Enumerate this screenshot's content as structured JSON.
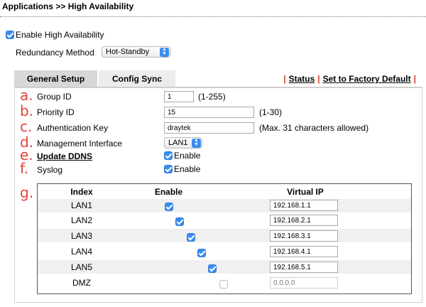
{
  "breadcrumb": "Applications >> High Availability",
  "enable_ha": {
    "label": "Enable High Availability",
    "checked": true
  },
  "redundancy": {
    "label": "Redundancy Method",
    "value": "Hot-Standby"
  },
  "tabs": [
    {
      "label": "General Setup",
      "active": true
    },
    {
      "label": "Config Sync",
      "active": false
    }
  ],
  "links": {
    "status": "Status",
    "factory": "Set to Factory Default"
  },
  "markers": {
    "a": "a.",
    "b": "b.",
    "c": "c.",
    "d": "d.",
    "e": "e.",
    "f": "f.",
    "g": "g."
  },
  "fields": {
    "group_id": {
      "label": "Group ID",
      "value": "1",
      "hint": "(1-255)"
    },
    "priority_id": {
      "label": "Priority ID",
      "value": "15",
      "hint": "(1-30)"
    },
    "auth_key": {
      "label": "Authentication Key",
      "value": "draytek",
      "hint": "(Max. 31 characters allowed)"
    },
    "mgmt_interface": {
      "label": "Management Interface",
      "value": "LAN1"
    },
    "update_ddns": {
      "label": "Update DDNS",
      "option": "Enable",
      "checked": true
    },
    "syslog": {
      "label": "Syslog",
      "option": "Enable",
      "checked": true
    }
  },
  "vip_table": {
    "headers": {
      "index": "Index",
      "enable": "Enable",
      "vip": "Virtual IP"
    },
    "rows": [
      {
        "index": "LAN1",
        "enabled": true,
        "ip": "192.168.1.1"
      },
      {
        "index": "LAN2",
        "enabled": true,
        "ip": "192.168.2.1"
      },
      {
        "index": "LAN3",
        "enabled": true,
        "ip": "192.168.3.1"
      },
      {
        "index": "LAN4",
        "enabled": true,
        "ip": "192.168.4.1"
      },
      {
        "index": "LAN5",
        "enabled": true,
        "ip": "192.168.5.1"
      },
      {
        "index": "DMZ",
        "enabled": false,
        "ip": "0.0.0.0"
      }
    ]
  },
  "colors": {
    "accent": "#3b8cf0",
    "marker": "#e0453a",
    "separator": "#d9342b"
  }
}
